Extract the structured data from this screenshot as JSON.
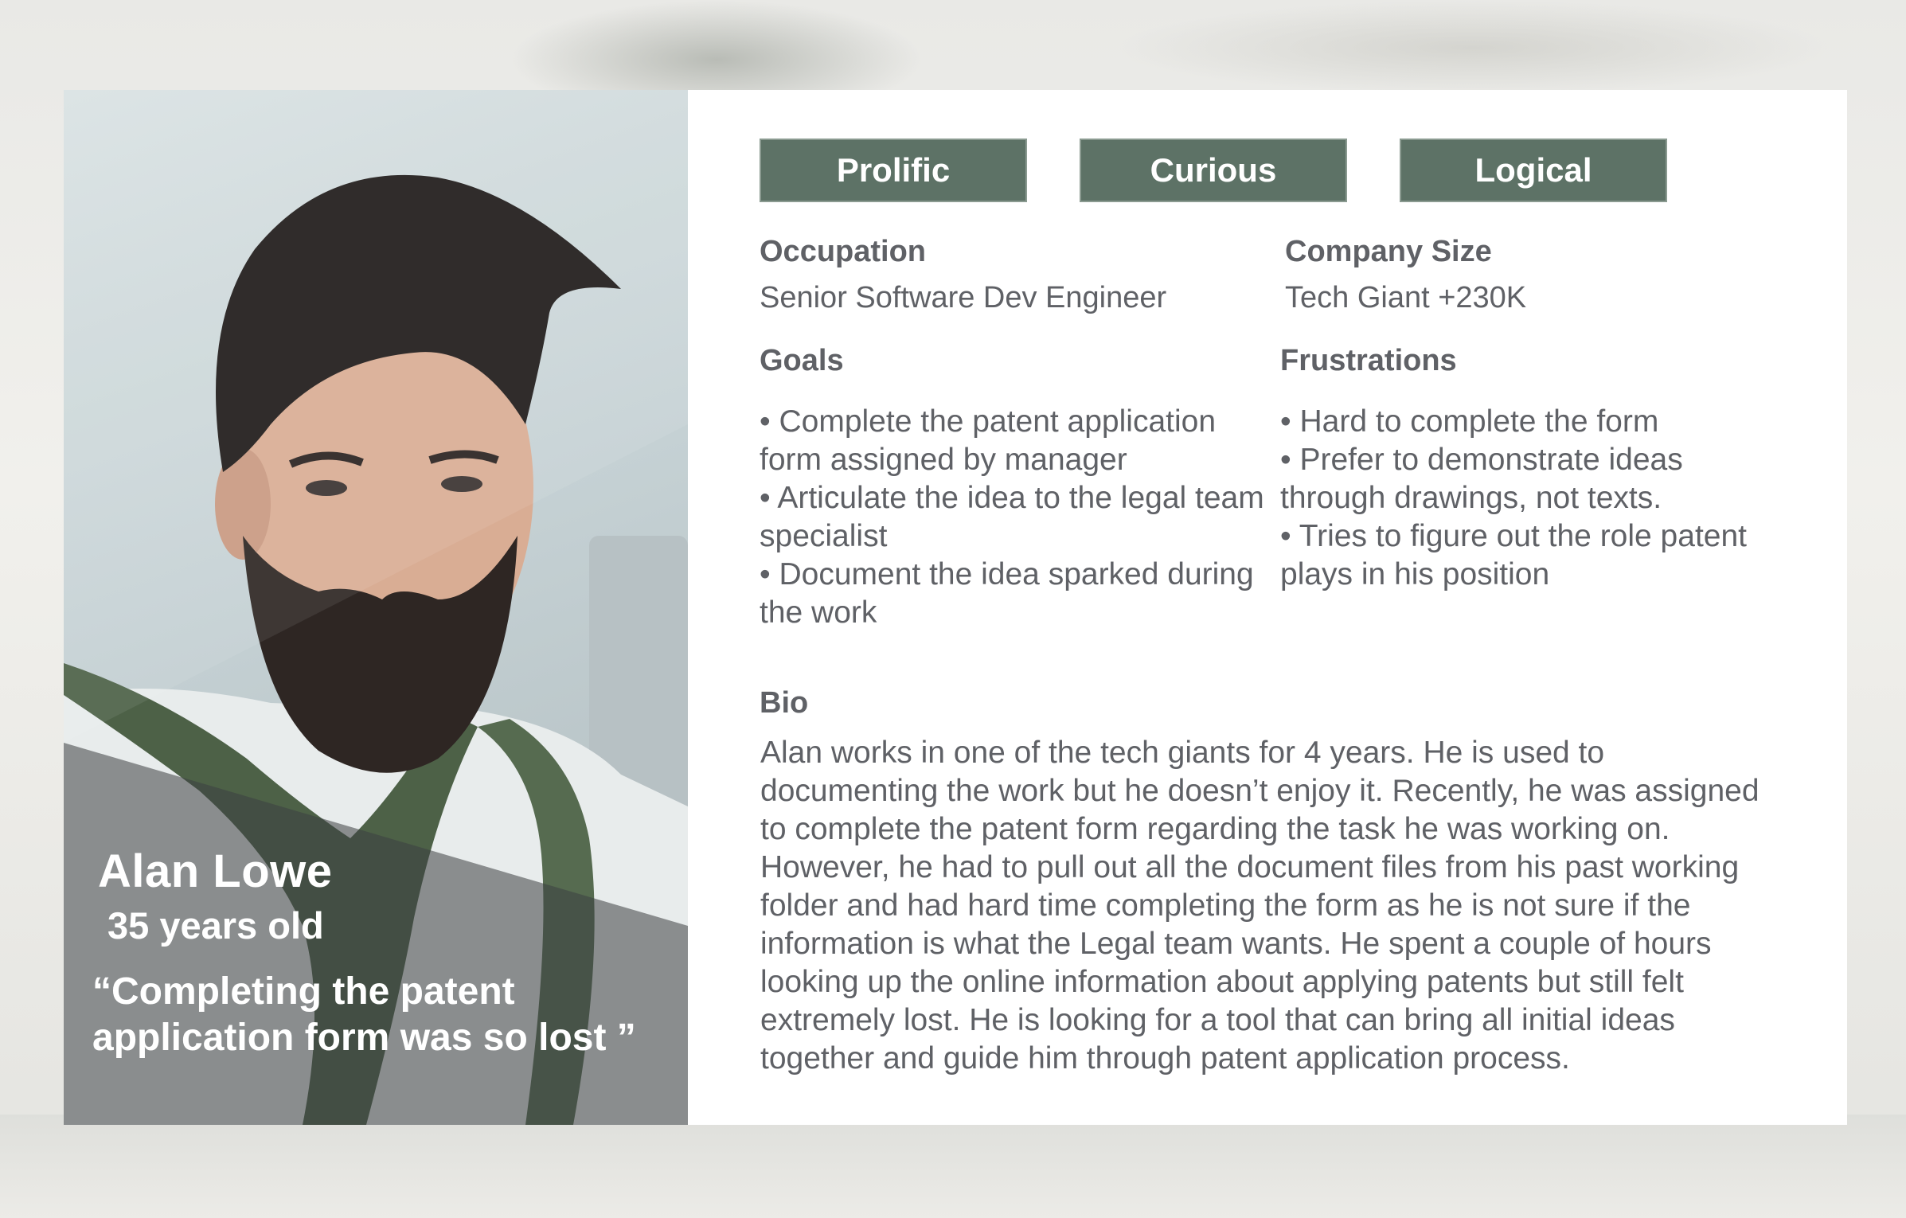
{
  "persona": {
    "name": "Alan Lowe",
    "age": "35 years old",
    "quote": "“Completing the patent application form was so lost ”"
  },
  "traits": [
    "Prolific",
    "Curious",
    "Logical"
  ],
  "occupation": {
    "heading": "Occupation",
    "value": "Senior Software Dev Engineer"
  },
  "company_size": {
    "heading": "Company Size",
    "value": "Tech Giant +230K"
  },
  "goals": {
    "heading": "Goals",
    "items": [
      "• Complete the patent application form assigned by manager",
      "• Articulate the idea to the legal team specialist",
      "• Document the idea sparked during the work"
    ]
  },
  "frustrations": {
    "heading": "Frustrations",
    "items": [
      "• Hard to complete the form",
      "• Prefer to demonstrate ideas through drawings, not texts.",
      "• Tries to figure out the role patent plays in his position"
    ]
  },
  "bio": {
    "heading": "Bio",
    "text": "Alan works in one of the tech giants for 4 years. He is used to documenting the work but he doesn’t enjoy it. Recently, he was assigned to complete the patent form regarding the task he was working on. However, he had to pull out all the document files from his past working folder and had hard time completing the form as he is not sure if the information is what the Legal team wants. He spent a couple of hours looking up the online information about applying patents but still felt extremely lost. He is looking for a tool that can bring all initial ideas together and guide him through patent application process."
  },
  "colors": {
    "tag_background": "#5d7266",
    "text": "#5f6166",
    "card": "#ffffff"
  }
}
